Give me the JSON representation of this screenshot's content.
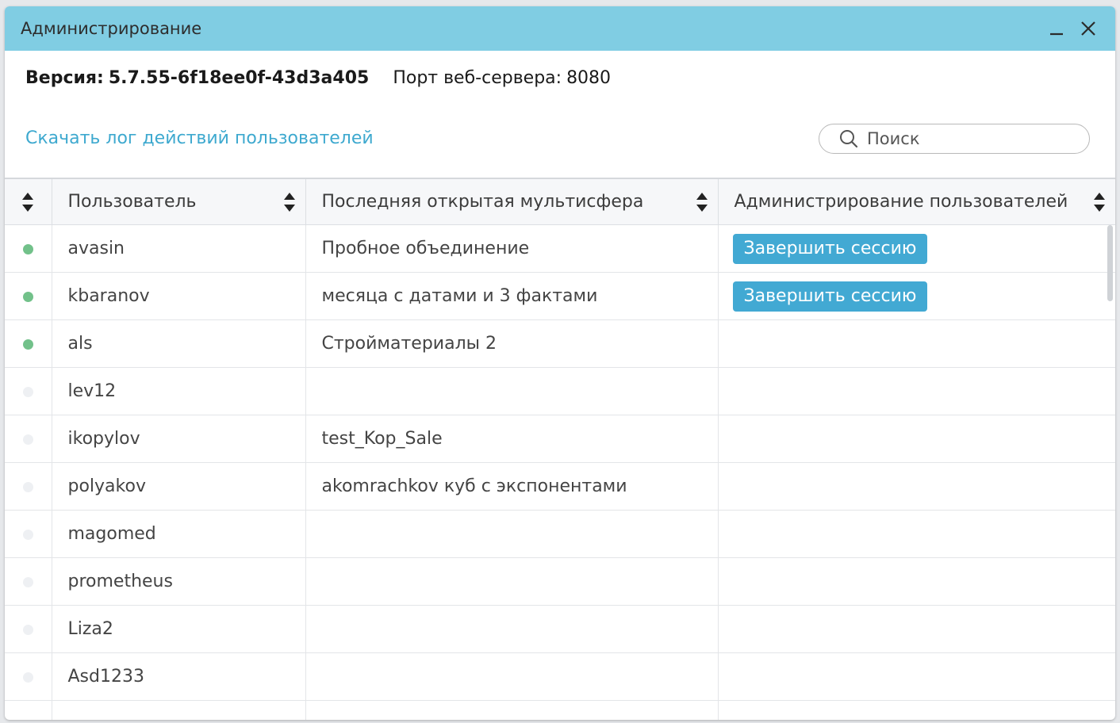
{
  "window": {
    "title": "Администрирование"
  },
  "info": {
    "version_label": "Версия:",
    "version_value": "5.7.55-6f18ee0f-43d3a405",
    "port_label": "Порт веб-сервера:",
    "port_value": "8080"
  },
  "log_link": "Скачать лог действий пользователей",
  "search": {
    "placeholder": "Поиск",
    "value": ""
  },
  "table": {
    "columns": [
      "",
      "Пользователь",
      "Последняя открытая мультисфера",
      "Администрирование пользователей"
    ],
    "end_session_label": "Завершить сессию",
    "rows": [
      {
        "online": true,
        "user": "avasin",
        "multisphere": "Пробное объединение",
        "action": "Завершить сессию"
      },
      {
        "online": true,
        "user": "kbaranov",
        "multisphere": "месяца с датами и 3 фактами",
        "action": "Завершить сессию"
      },
      {
        "online": true,
        "user": "als",
        "multisphere": "Стройматериалы 2",
        "action": ""
      },
      {
        "online": false,
        "user": "lev12",
        "multisphere": "",
        "action": ""
      },
      {
        "online": false,
        "user": "ikopylov",
        "multisphere": "test_Kop_Sale",
        "action": ""
      },
      {
        "online": false,
        "user": "polyakov",
        "multisphere": "akomrachkov куб с экспонентами",
        "action": ""
      },
      {
        "online": false,
        "user": "magomed",
        "multisphere": "",
        "action": ""
      },
      {
        "online": false,
        "user": "prometheus",
        "multisphere": "",
        "action": ""
      },
      {
        "online": false,
        "user": "Liza2",
        "multisphere": "",
        "action": ""
      },
      {
        "online": false,
        "user": "Asd1233",
        "multisphere": "",
        "action": ""
      },
      {
        "online": false,
        "user": "",
        "multisphere": "",
        "action": ""
      }
    ]
  },
  "colors": {
    "titlebar": "#80cde3",
    "link": "#3ea9cf",
    "button": "#42a9d3",
    "online": "#72c18a",
    "offline": "#eef0f3"
  },
  "icons": {
    "minimize": "minimize-icon",
    "close": "close-icon",
    "search": "search-icon",
    "sort": "sort-arrows-icon"
  }
}
